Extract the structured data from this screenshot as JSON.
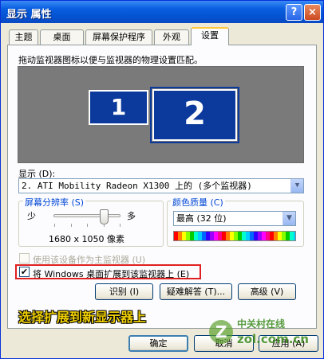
{
  "window": {
    "title": "显示 属性",
    "help_glyph": "?",
    "close_glyph": "×"
  },
  "tabs": [
    {
      "label": "主题"
    },
    {
      "label": "桌面"
    },
    {
      "label": "屏幕保护程序"
    },
    {
      "label": "外观"
    },
    {
      "label": "设置",
      "active": true
    }
  ],
  "settings": {
    "instruction": "拖动监视器图标以便与监视器的物理设置匹配。",
    "monitors": [
      {
        "label": "1"
      },
      {
        "label": "2",
        "selected": true
      }
    ],
    "display_label": "显示 (D):",
    "display_value": "2. ATI Mobility Radeon X1300 上的 (多个监视器)",
    "resolution": {
      "title": "屏幕分辨率 (S)",
      "min_label": "少",
      "max_label": "多",
      "value": "1680 x 1050 像素",
      "slider_fraction": 0.75
    },
    "color_quality": {
      "title": "颜色质量 (C)",
      "value": "最高 (32 位)"
    },
    "primary_checkbox": {
      "label": "使用该设备作为主监视器 (U)",
      "checked": false,
      "enabled": false
    },
    "extend_checkbox": {
      "label": "将 Windows 桌面扩展到该监视器上 (E)",
      "checked": true,
      "check_glyph": "✔"
    },
    "buttons": {
      "identify": "识别 (I)",
      "troubleshoot": "疑难解答 (T)...",
      "advanced": "高级 (V)"
    }
  },
  "annotation": "选择扩展到新显示器上",
  "dialog_buttons": {
    "ok": "确定",
    "cancel": "取消",
    "apply": "应用 (A)"
  },
  "watermark": {
    "text": "中关村在线",
    "url": "zol.com.cn",
    "logo_letter": "Z"
  },
  "colors": {
    "title_bar": "#0a5fe0",
    "caption": "#f0d000",
    "highlight_box": "#e02020",
    "monitor_blue": "#0b3a9c"
  }
}
